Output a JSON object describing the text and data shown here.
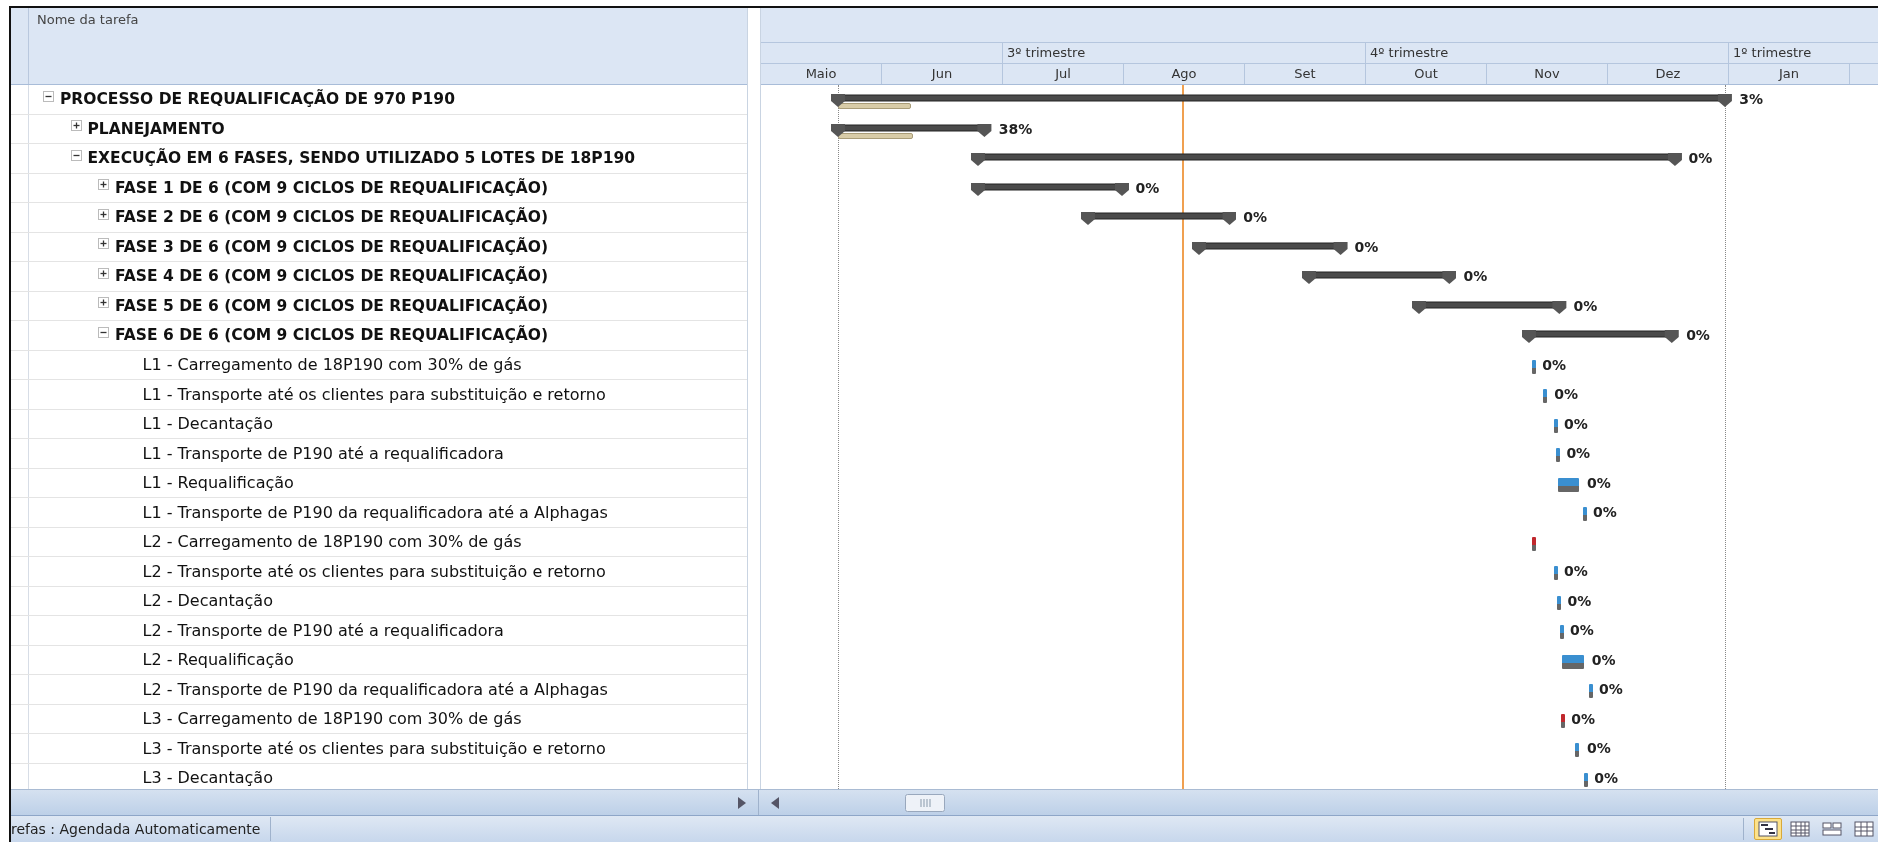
{
  "table": {
    "columns": [
      "Nome da tarefa"
    ]
  },
  "timescale": {
    "quarters": [
      {
        "label": "3º trimestre"
      },
      {
        "label": "4º trimestre"
      },
      {
        "label": "1º trimestre"
      }
    ],
    "months": [
      "Maio",
      "Jun",
      "Jul",
      "Ago",
      "Set",
      "Out",
      "Nov",
      "Dez",
      "Jan"
    ]
  },
  "tasks": [
    {
      "name": "PROCESSO DE REQUALIFICAÇÃO DE 970 P190",
      "kind": "summary",
      "expanded": true,
      "complete": "3%",
      "children": [
        {
          "name": "PLANEJAMENTO",
          "kind": "summary",
          "expanded": false,
          "complete": "38%"
        },
        {
          "name": "EXECUÇÃO EM 6 FASES, SENDO UTILIZADO 5 LOTES DE 18P190",
          "kind": "summary",
          "expanded": true,
          "complete": "0%",
          "children": [
            {
              "name": "FASE 1 DE 6 (COM 9 CICLOS DE REQUALIFICAÇÃO)",
              "kind": "summary",
              "expanded": false,
              "complete": "0%"
            },
            {
              "name": "FASE 2 DE 6 (COM 9 CICLOS DE REQUALIFICAÇÃO)",
              "kind": "summary",
              "expanded": false,
              "complete": "0%"
            },
            {
              "name": "FASE 3 DE 6 (COM 9 CICLOS DE REQUALIFICAÇÃO)",
              "kind": "summary",
              "expanded": false,
              "complete": "0%"
            },
            {
              "name": "FASE 4 DE 6 (COM 9 CICLOS DE REQUALIFICAÇÃO)",
              "kind": "summary",
              "expanded": false,
              "complete": "0%"
            },
            {
              "name": "FASE 5 DE 6 (COM 9 CICLOS DE REQUALIFICAÇÃO)",
              "kind": "summary",
              "expanded": false,
              "complete": "0%"
            },
            {
              "name": "FASE 6 DE 6 (COM 9 CICLOS DE REQUALIFICAÇÃO)",
              "kind": "summary",
              "expanded": true,
              "complete": "0%",
              "children": [
                {
                  "name": "L1 - Carregamento de 18P190 com 30% de gás",
                  "kind": "task",
                  "critical": false,
                  "complete": "0%"
                },
                {
                  "name": "L1 - Transporte até os clientes para substituição e retorno",
                  "kind": "task",
                  "critical": false,
                  "complete": "0%"
                },
                {
                  "name": "L1 - Decantação",
                  "kind": "task",
                  "critical": false,
                  "complete": "0%"
                },
                {
                  "name": "L1 - Transporte de P190 até a requalificadora",
                  "kind": "task",
                  "critical": false,
                  "complete": "0%"
                },
                {
                  "name": "L1 - Requalificação",
                  "kind": "task",
                  "critical": false,
                  "complete": "0%"
                },
                {
                  "name": "L1 - Transporte de P190 da requalificadora até a Alphagas",
                  "kind": "task",
                  "critical": false,
                  "complete": "0%"
                },
                {
                  "name": "L2 - Carregamento de 18P190 com 30% de gás",
                  "kind": "task",
                  "critical": true
                },
                {
                  "name": "L2 - Transporte até os clientes para substituição e retorno",
                  "kind": "task",
                  "critical": false,
                  "complete": "0%"
                },
                {
                  "name": "L2 - Decantação",
                  "kind": "task",
                  "critical": false,
                  "complete": "0%"
                },
                {
                  "name": "L2 - Transporte de P190 até a requalificadora",
                  "kind": "task",
                  "critical": false,
                  "complete": "0%"
                },
                {
                  "name": "L2 - Requalificação",
                  "kind": "task",
                  "critical": false,
                  "complete": "0%"
                },
                {
                  "name": "L2 - Transporte de P190 da requalificadora até a Alphagas",
                  "kind": "task",
                  "critical": false,
                  "complete": "0%"
                },
                {
                  "name": "L3 - Carregamento de 18P190 com 30% de gás",
                  "kind": "task",
                  "critical": true,
                  "complete": "0%"
                },
                {
                  "name": "L3 - Transporte até os clientes para substituição e retorno",
                  "kind": "task",
                  "critical": false,
                  "complete": "0%"
                },
                {
                  "name": "L3 - Decantação",
                  "kind": "task",
                  "critical": false,
                  "complete": "0%"
                }
              ]
            }
          ]
        }
      ]
    }
  ],
  "status_bar": {
    "text": "refas : Agendada Automaticamente",
    "views": [
      {
        "kind": "gantt",
        "selected": true
      },
      {
        "kind": "table",
        "selected": false
      },
      {
        "kind": "form",
        "selected": false
      },
      {
        "kind": "grid",
        "selected": false
      }
    ]
  }
}
